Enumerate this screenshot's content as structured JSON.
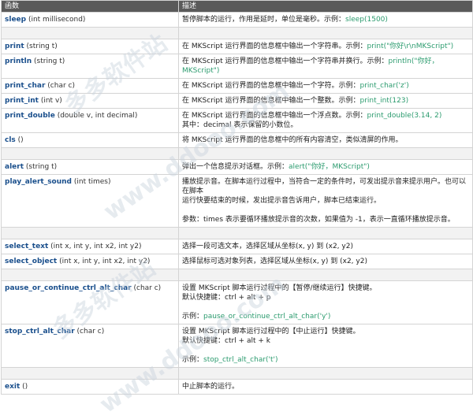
{
  "header": {
    "col1": "函数",
    "col2": "描述"
  },
  "rows": [
    {
      "type": "fn",
      "name": "sleep",
      "sig": " (int millisecond)",
      "desc": [
        "暂停脚本的运行，作用是延时，单位是毫秒。示例："
      ],
      "code": "sleep(1500)",
      "code_line": 0
    },
    {
      "type": "spacer"
    },
    {
      "type": "fn",
      "name": "print",
      "sig": " (string t)",
      "desc": [
        "在 MKScript 运行界面的信息框中输出一个字符串。示例："
      ],
      "code": "print(\"你好\\r\\nMKScript\")",
      "code_line": 0
    },
    {
      "type": "fn",
      "name": "println",
      "sig": " (string t)",
      "desc": [
        "在 MKScript 运行界面的信息框中输出一个字符串并换行。示例："
      ],
      "code": "println(\"你好，MKScript\")",
      "code_line": 0
    },
    {
      "type": "fn",
      "name": "print_char",
      "sig": " (char c)",
      "desc": [
        "在 MKScript 运行界面的信息框中输出一个字符。示例："
      ],
      "code": "print_char('z')",
      "code_line": 0
    },
    {
      "type": "fn",
      "name": "print_int",
      "sig": " (int v)",
      "desc": [
        "在 MKScript 运行界面的信息框中输出一个整数。示例："
      ],
      "code": "print_int(123)",
      "code_line": 0
    },
    {
      "type": "fn",
      "name": "print_double",
      "sig": " (double v, int decimal)",
      "desc": [
        "在 MKScript 运行界面的信息框中输出一个浮点数。示例：",
        "其中：decimal 表示保留的小数位。"
      ],
      "code": "print_double(3.14, 2)",
      "code_line": 0
    },
    {
      "type": "fn",
      "name": "cls",
      "sig": " ()",
      "desc": [
        "将 MKScript 运行界面的信息框中的所有内容清空，类似清屏的作用。"
      ]
    },
    {
      "type": "spacer"
    },
    {
      "type": "fn",
      "name": "alert",
      "sig": " (string t)",
      "desc": [
        "弹出一个信息提示对话框。示例："
      ],
      "code": "alert(\"你好，MKScript\")",
      "code_line": 0
    },
    {
      "type": "fn",
      "name": "play_alert_sound",
      "sig": " (int times)",
      "desc": [
        "播放提示音。在脚本运行过程中，当符合一定的条件时，可发出提示音来提示用户。也可以在脚本",
        "运行快要结束的时候，发出提示音告诉用户，脚本已结束运行。",
        "",
        "参数：times 表示要循环播放提示音的次数，如果值为 -1，表示一直循环播放提示音。"
      ]
    },
    {
      "type": "spacer"
    },
    {
      "type": "fn",
      "name": "select_text",
      "sig": " (int x, int y, int x2, int y2)",
      "desc": [
        "选择一段可选文本，选择区域从坐标(x, y) 到 (x2, y2)"
      ]
    },
    {
      "type": "fn",
      "name": "select_object",
      "sig": " (int x, int y, int x2, int y2)",
      "desc": [
        "选择鼠标可选对象列表，选择区域从坐标(x, y) 到 (x2, y2)"
      ]
    },
    {
      "type": "spacer"
    },
    {
      "type": "fn",
      "name": "pause_or_continue_ctrl_alt_char",
      "sig": " (char c)",
      "desc": [
        "设置 MKScript 脚本运行过程中的【暂停/继续运行】快捷键。",
        "默认快捷键：ctrl + alt + p",
        "",
        "示例："
      ],
      "code": "pause_or_continue_ctrl_alt_char('y')",
      "code_line": 3
    },
    {
      "type": "fn",
      "name": "stop_ctrl_alt_char",
      "sig": " (char c)",
      "desc": [
        "设置 MKScript 脚本运行过程中的【中止运行】快捷键。",
        "默认快捷键：ctrl + alt + k",
        "",
        "示例："
      ],
      "code": "stop_ctrl_alt_char('t')",
      "code_line": 3
    },
    {
      "type": "spacer"
    },
    {
      "type": "fn",
      "name": "exit",
      "sig": " ()",
      "desc": [
        "中止脚本的运行。"
      ]
    }
  ],
  "watermarks": [
    "多多软件站",
    "www.ddooo.com",
    "多多软件站",
    "www.ddooo.com"
  ]
}
